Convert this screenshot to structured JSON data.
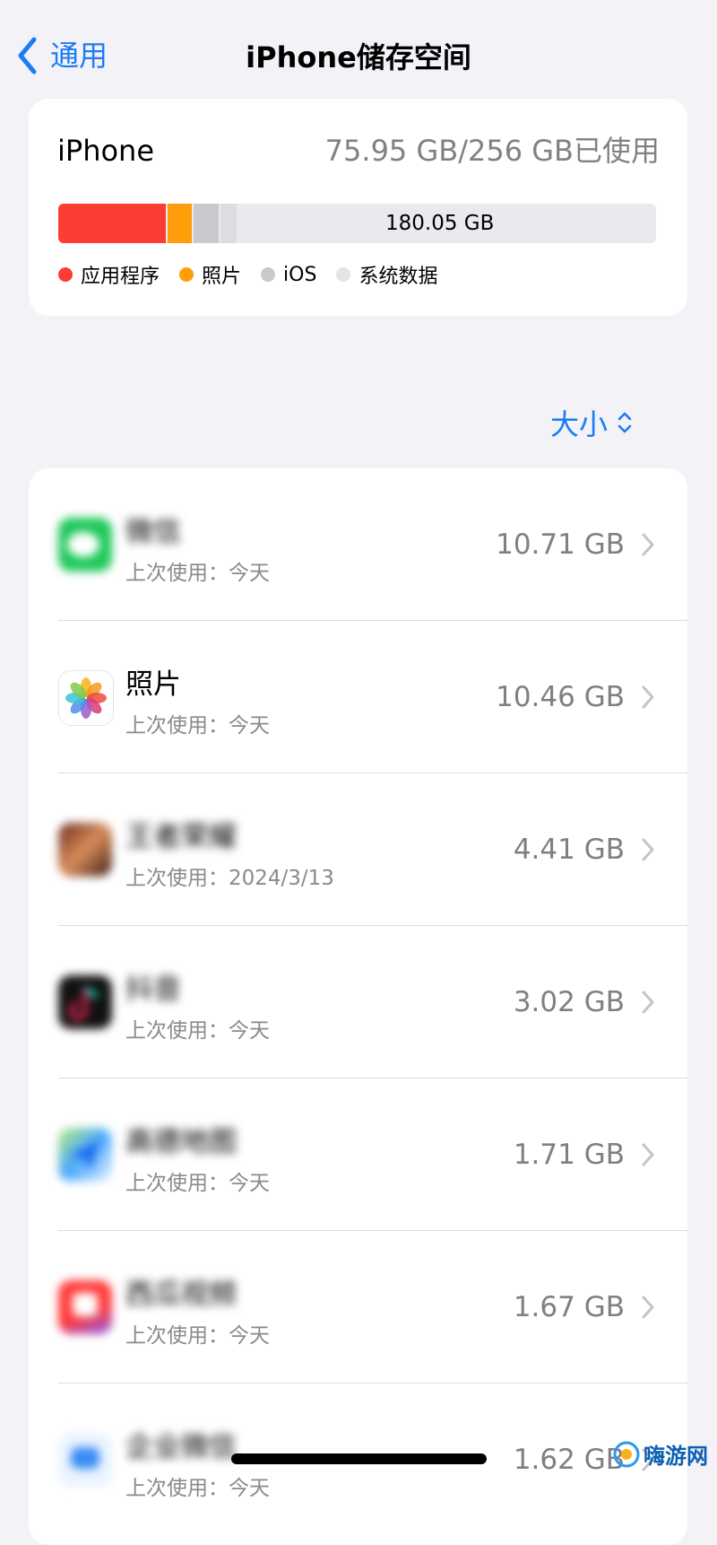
{
  "nav": {
    "back_label": "通用",
    "title": "iPhone储存空间"
  },
  "summary": {
    "device": "iPhone",
    "usage": "75.95 GB/256 GB已使用",
    "free": "180.05 GB",
    "legend": [
      {
        "label": "应用程序",
        "color": "#fb3d33"
      },
      {
        "label": "照片",
        "color": "#ff9e0a"
      },
      {
        "label": "iOS",
        "color": "#c8c8cd"
      },
      {
        "label": "系统数据",
        "color": "#e3e3e8"
      }
    ]
  },
  "sort": {
    "label": "大小"
  },
  "apps": [
    {
      "name": "微信",
      "last_used": "上次使用：今天",
      "size": "10.71 GB",
      "icon": "wechat-icon"
    },
    {
      "name": "照片",
      "last_used": "上次使用：今天",
      "size": "10.46 GB",
      "icon": "photos-icon"
    },
    {
      "name": "王者荣耀",
      "last_used": "上次使用：2024/3/13",
      "size": "4.41 GB",
      "icon": "game-icon"
    },
    {
      "name": "抖音",
      "last_used": "上次使用：今天",
      "size": "3.02 GB",
      "icon": "douyin-icon"
    },
    {
      "name": "高德地图",
      "last_used": "上次使用：今天",
      "size": "1.71 GB",
      "icon": "map-icon"
    },
    {
      "name": "西瓜视频",
      "last_used": "上次使用：今天",
      "size": "1.67 GB",
      "icon": "video-icon"
    },
    {
      "name": "企业微信",
      "last_used": "上次使用：今天",
      "size": "1.62 GB",
      "icon": "work-chat-icon"
    }
  ],
  "watermark": "嗨游网"
}
